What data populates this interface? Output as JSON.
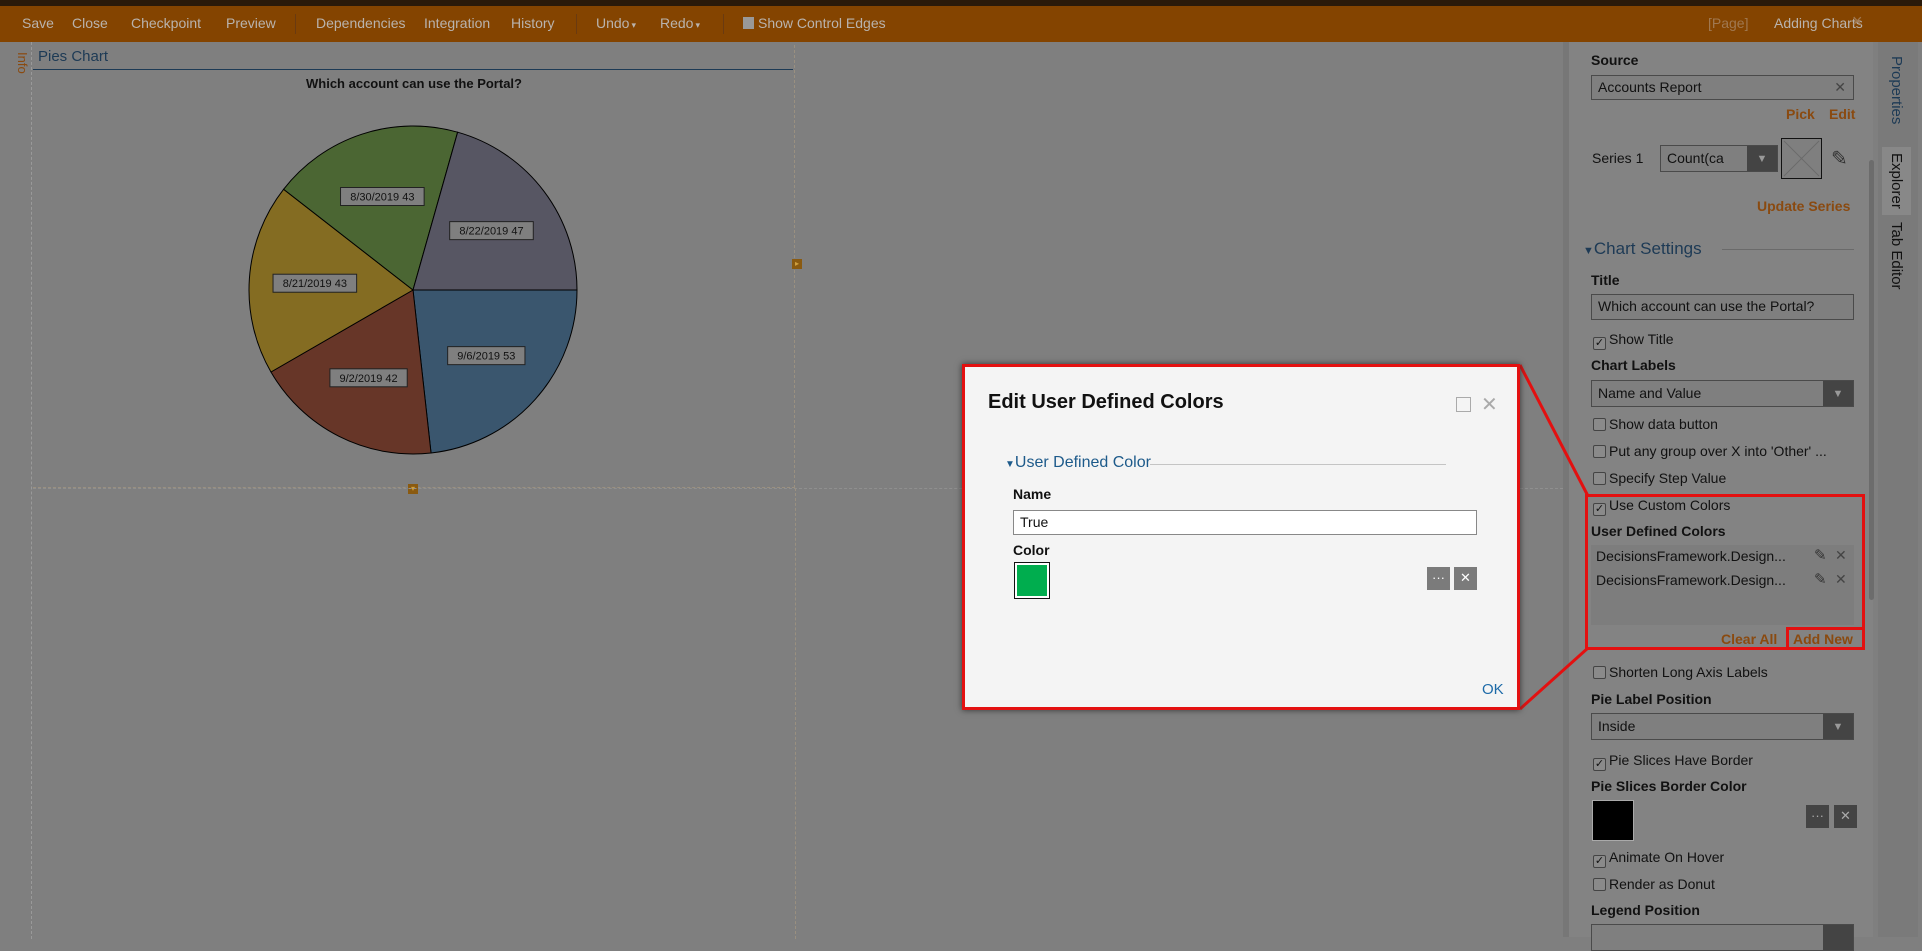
{
  "toolbar": {
    "items": [
      "Save",
      "Close",
      "Checkpoint",
      "Preview",
      "Dependencies",
      "Integration",
      "History",
      "Undo",
      "Redo",
      "Show Control Edges"
    ],
    "page_tag": "[Page]",
    "page_name": "Adding Charts",
    "close": "×"
  },
  "left_tab": "Info",
  "chart": {
    "name": "Pies Chart"
  },
  "chart_data": {
    "type": "pie",
    "title": "Which account can use the Portal?",
    "categories": [
      "9/6/2019",
      "9/2/2019",
      "8/21/2019",
      "8/30/2019",
      "8/22/2019"
    ],
    "values": [
      53,
      42,
      43,
      43,
      47
    ],
    "colors": [
      "#3a566e",
      "#673628",
      "#846c22",
      "#4b6633",
      "#575663"
    ],
    "labels": [
      "9/6/2019 53",
      "9/2/2019 42",
      "8/21/2019 43",
      "8/30/2019 43",
      "8/22/2019 47"
    ],
    "border_color": "#000000",
    "start": "3 o'clock, clockwise"
  },
  "panel": {
    "source_label": "Source",
    "source_value": "Accounts Report",
    "pick": "Pick",
    "edit": "Edit",
    "series_label": "Series 1",
    "series_value": "Count(ca",
    "update_series": "Update Series",
    "chart_settings": "Chart Settings",
    "title_label": "Title",
    "title_value": "Which account can use the Portal?",
    "show_title": "Show Title",
    "chart_labels": "Chart Labels",
    "chart_labels_value": "Name and Value",
    "show_data_button": "Show data button",
    "put_other": "Put any group over X into 'Other' ...",
    "step_value": "Specify Step Value",
    "use_custom_colors": "Use Custom Colors",
    "user_defined_colors": "User Defined Colors",
    "colors_list": [
      "DecisionsFramework.Design...",
      "DecisionsFramework.Design..."
    ],
    "clear_all": "Clear All",
    "add_new": "Add New",
    "shorten": "Shorten Long Axis Labels",
    "pie_label_position": "Pie Label Position",
    "pie_label_value": "Inside",
    "pie_border": "Pie Slices Have Border",
    "border_color_label": "Pie Slices Border Color",
    "border_color": "#000000",
    "animate": "Animate On Hover",
    "donut": "Render as Donut",
    "legend_position": "Legend Position"
  },
  "tabs": [
    "Properties",
    "Explorer",
    "Tab Editor"
  ],
  "dialog": {
    "title": "Edit User Defined Colors",
    "section": "User Defined Color",
    "name_label": "Name",
    "name_value": "True",
    "color_label": "Color",
    "color": "#00ad4e",
    "ok": "OK"
  }
}
